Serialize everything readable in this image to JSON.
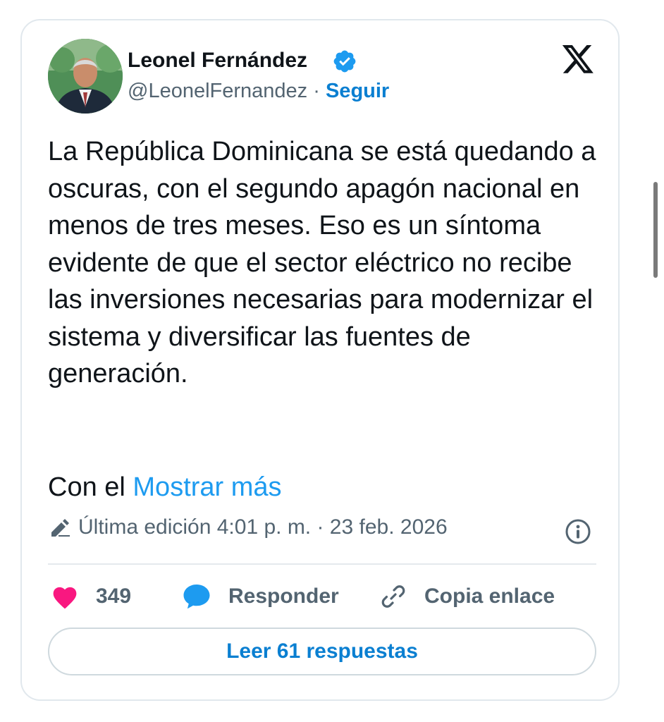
{
  "author": {
    "name": "Leonel Fernández",
    "handle": "@LeonelFernandez",
    "separator": "·",
    "follow_label": "Seguir"
  },
  "platform_icon": "x-logo-icon",
  "tweet": {
    "text": "La República Dominicana se está quedando a oscuras, con el segundo apagón nacional en menos de tres meses. Eso es un síntoma evidente de que el sector eléctrico no recibe las inversiones necesarias para modernizar el sistema y diversificar las fuentes de generación.",
    "continuation": "Con el",
    "show_more_label": "Mostrar más"
  },
  "edit_info": "Última edición 4:01 p. m. · 23 feb. 2026",
  "actions": {
    "like_count": "349",
    "reply_label": "Responder",
    "copy_label": "Copia enlace"
  },
  "read_replies_label": "Leer 61 respuestas",
  "colors": {
    "accent": "#1d9bf0",
    "like": "#f91880",
    "text": "#0f1419",
    "muted": "#536471"
  }
}
